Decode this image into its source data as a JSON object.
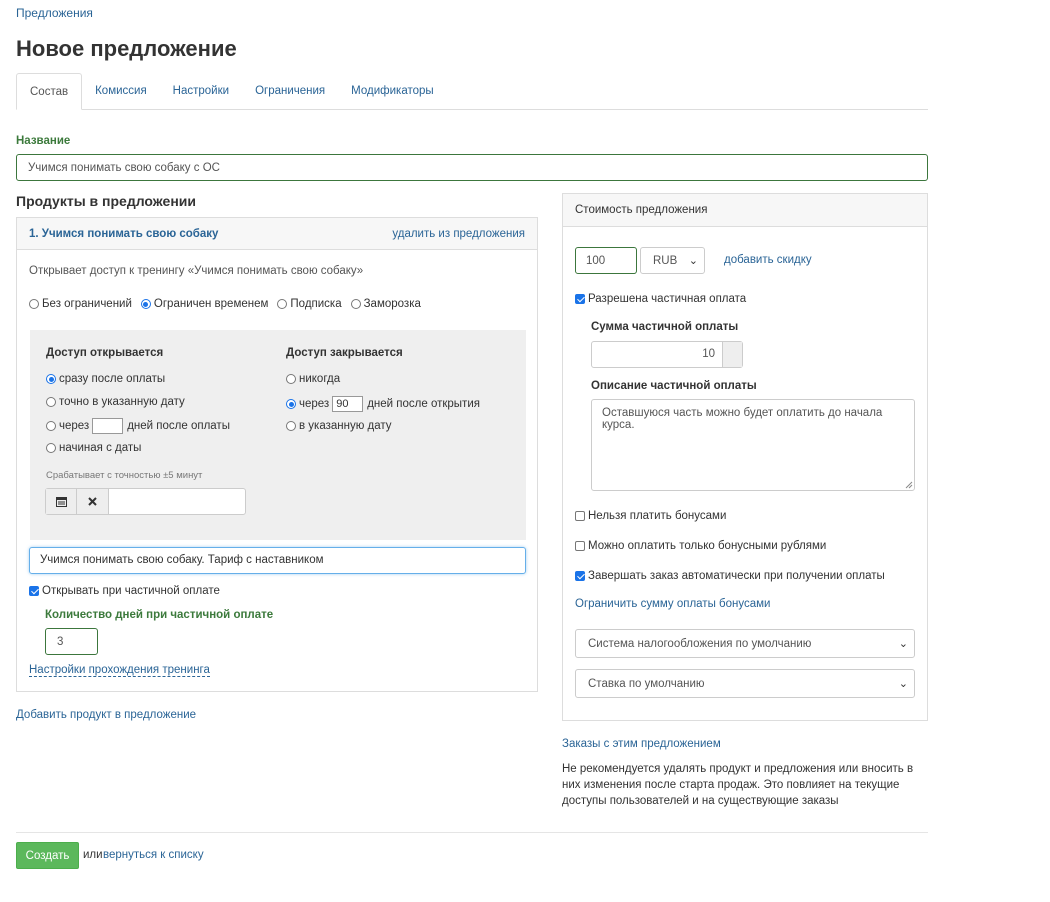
{
  "breadcrumb": "Предложения",
  "page_title": "Новое предложение",
  "tabs": [
    {
      "label": "Состав"
    },
    {
      "label": "Комиссия"
    },
    {
      "label": "Настройки"
    },
    {
      "label": "Ограничения"
    },
    {
      "label": "Модификаторы"
    }
  ],
  "name_field": {
    "label": "Название",
    "value": "Учимся понимать свою собаку с ОС"
  },
  "products": {
    "title": "Продукты в предложении",
    "item": {
      "title": "1. Учимся понимать свою собаку",
      "remove_link": "удалить из предложения",
      "description": "Открывает доступ к тренингу «Учимся понимать свою собаку»",
      "access_types": [
        "Без ограничений",
        "Ограничен временем",
        "Подписка",
        "Заморозка"
      ],
      "access_opens": {
        "heading": "Доступ открывается",
        "opt_after_payment": "сразу после оплаты",
        "opt_date": "точно в указанную дату",
        "opt_via_prefix": "через",
        "opt_via_value": "",
        "opt_via_suffix": "дней после оплаты",
        "opt_from_date": "начиная с даты",
        "precision_note": "Срабатывает с точностью ±5 минут",
        "date_value": ""
      },
      "access_closes": {
        "heading": "Доступ закрывается",
        "opt_never": "никогда",
        "opt_via_prefix": "через",
        "opt_via_value": "90",
        "opt_via_suffix": "дней после открытия",
        "opt_date": "в указанную дату"
      },
      "tariff_value": "Учимся понимать свою собаку. Тариф с наставником",
      "open_on_partial": "Открывать при частичной оплате",
      "partial_days_label": "Количество дней при частичной оплате",
      "partial_days_value": "3",
      "training_settings_link": "Настройки прохождения тренинга"
    },
    "add_product_link": "Добавить продукт в предложение"
  },
  "price_panel": {
    "title": "Стоимость предложения",
    "price_value": "100",
    "currency": "RUB",
    "add_discount": "добавить скидку",
    "partial_allowed": "Разрешена частичная оплата",
    "partial_sum_label": "Сумма частичной оплаты",
    "partial_sum_value": "10",
    "partial_desc_label": "Описание частичной оплаты",
    "partial_desc_value": "Оставшуюся часть можно будет оплатить до начала курса.",
    "no_bonus": "Нельзя платить бонусами",
    "only_bonus": "Можно оплатить только бонусными рублями",
    "auto_complete": "Завершать заказ автоматически при получении оплаты",
    "limit_bonus_link": "Ограничить сумму оплаты бонусами",
    "tax_system": "Система налогообложения по умолчанию",
    "rate": "Ставка по умолчанию"
  },
  "orders_link": "Заказы с этим предложением",
  "warning_text": "Не рекомендуется удалять продукт и предложения или вносить в них изменения после старта продаж. Это повлияет на текущие доступы пользователей и на существующие заказы",
  "footer": {
    "create_button": "Создать",
    "or_text": "или",
    "back_link": "вернуться к списку"
  },
  "colors": {
    "accent": "#2a6496",
    "success": "#5cb85c",
    "label_green": "#3c7a3c",
    "radio_blue": "#1a73e8"
  },
  "icons": [
    "calendar-icon",
    "close-icon",
    "chevron-down-icon"
  ]
}
